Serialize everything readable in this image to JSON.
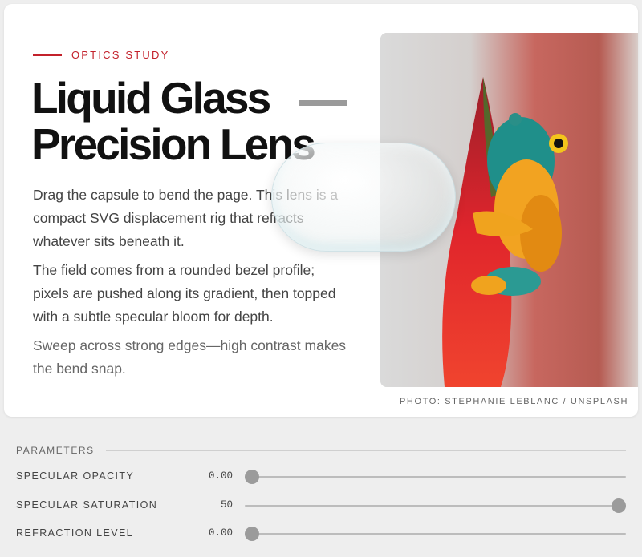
{
  "hero": {
    "eyebrow": "OPTICS STUDY",
    "title_line1": "Liquid Glass",
    "title_line2": "Precision Lens",
    "paragraphs": [
      "Drag the capsule to bend the page. This lens is a compact SVG displacement rig that refracts whatever sits beneath it.",
      "The field comes from a rounded bezel profile; pixels are pushed along its gradient, then topped with a subtle specular bloom for depth.",
      "Sweep across strong edges—high contrast makes the bend snap."
    ],
    "photo_caption": "PHOTO: STEPHANIE LEBLANC / UNSPLASH",
    "photo_subject": "tree-frog-on-red-flower",
    "accent_color": "#c3212b"
  },
  "parameters": {
    "heading": "PARAMETERS",
    "items": [
      {
        "label": "SPECULAR OPACITY",
        "value": "0.00",
        "level": 0.0
      },
      {
        "label": "SPECULAR SATURATION",
        "value": "50",
        "level": 1.0
      },
      {
        "label": "REFRACTION LEVEL",
        "value": "0.00",
        "level": 0.0
      }
    ]
  }
}
